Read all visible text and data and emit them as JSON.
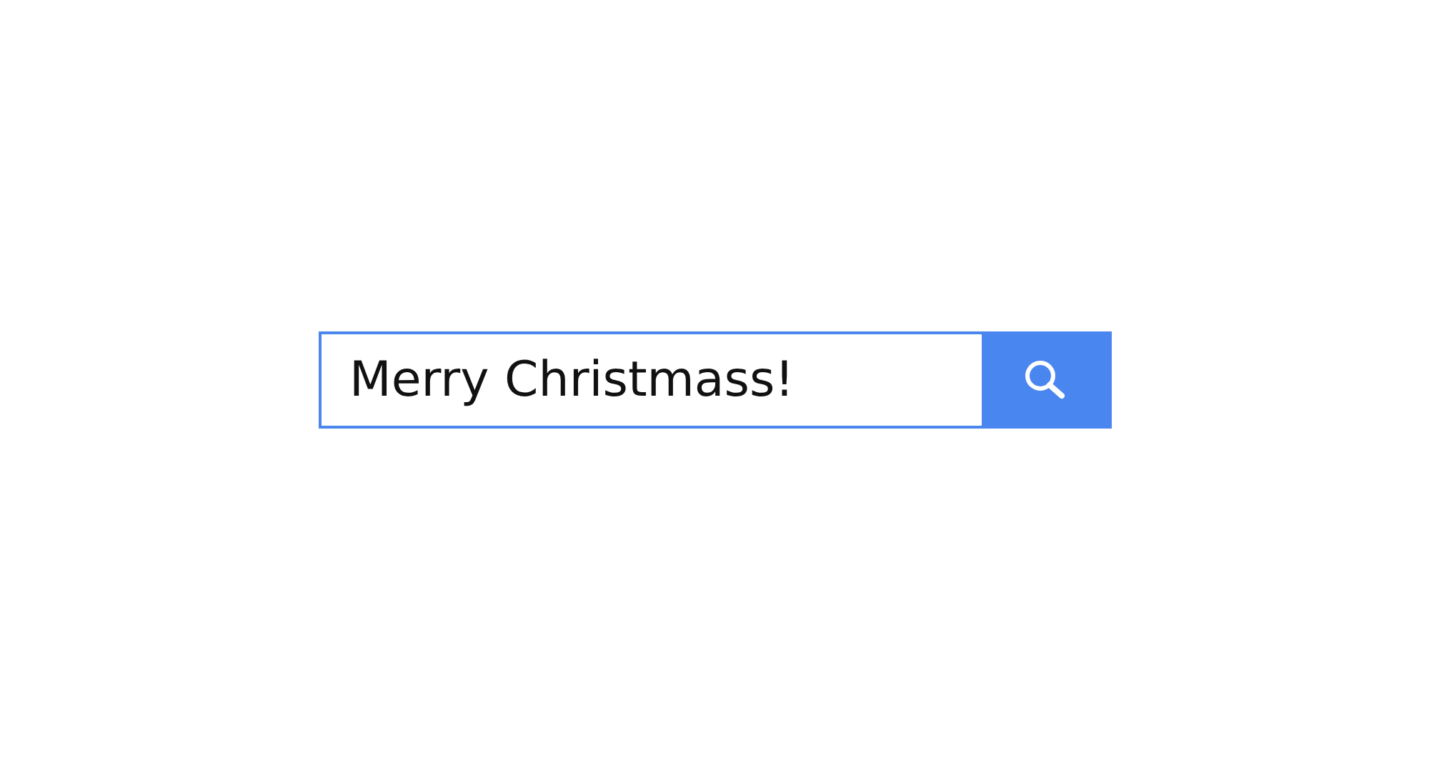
{
  "search": {
    "value": "Merry Christmass!"
  }
}
